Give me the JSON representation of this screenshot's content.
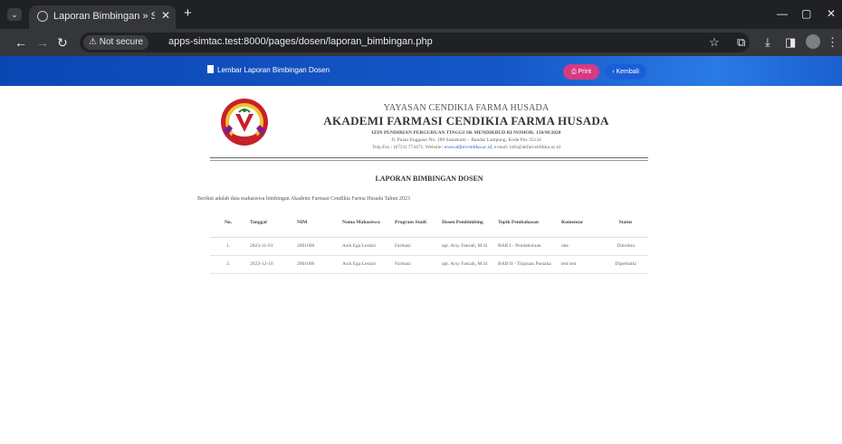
{
  "browser": {
    "tab_title": "Laporan Bimbingan » Sistem In",
    "security_label": "⚠ Not secure",
    "url": "apps-simtac.test:8000/pages/dosen/laporan_bimbingan.php"
  },
  "header": {
    "title": "Lembar Laporan Bimbingan Dosen",
    "print_label": "⎙ Print",
    "back_label": "‹ Kembali"
  },
  "kop": {
    "line1": "YAYASAN CENDIKIA FARMA HUSADA",
    "line2": "AKADEMI FARMASI CENDIKIA FARMA HUSADA",
    "line3": "IZIN PENDIRIAN PERGURUAN TINGGI SK MENDIKBUD RI NOMOR: 150/M/2020",
    "line4": "Jl. Pulau Enggano No. 188 Sukabumi – Bandar Lampung,  Kode Pos 35134",
    "line5_prefix": "Telp.Fax.: (0721) 774471,  Website: ",
    "website": "www.akfarcendika.ac.id",
    "line5_suffix": ",  e-mail: info@akfarcenfdika.ac.id"
  },
  "report": {
    "title": "LAPORAN BIMBINGAN DOSEN",
    "intro": "Berikut adalah data mahasiswa bimbingan Akademi Farmasi Cendikia Farma Husada Tahun 2023",
    "headers": [
      "No.",
      "Tanggal",
      "NIM",
      "Nama Mahasiswa",
      "Program Studi",
      "Dosen Pembimbing",
      "Topik Pembahasan",
      "Komentar",
      "Status"
    ],
    "rows": [
      [
        "1.",
        "2023-11-01",
        "2001006",
        "Asih Ega Lestari",
        "Farmasi",
        "apt. Arsy Faezah, M.Si",
        "BAB I - Pendahuluan",
        "oke",
        "Diterima"
      ],
      [
        "2.",
        "2023-12-10",
        "2001006",
        "Asih Ega Lestari",
        "Farmasi",
        "apt. Arsy Faezah, M.Si",
        "BAB II - Tinjauan Pustaka",
        "test test",
        "Diperbaiki"
      ]
    ]
  },
  "colors": {
    "header_bar": "#1657c8",
    "print_button": "#d63a82",
    "back_button": "#1a5fd8"
  }
}
